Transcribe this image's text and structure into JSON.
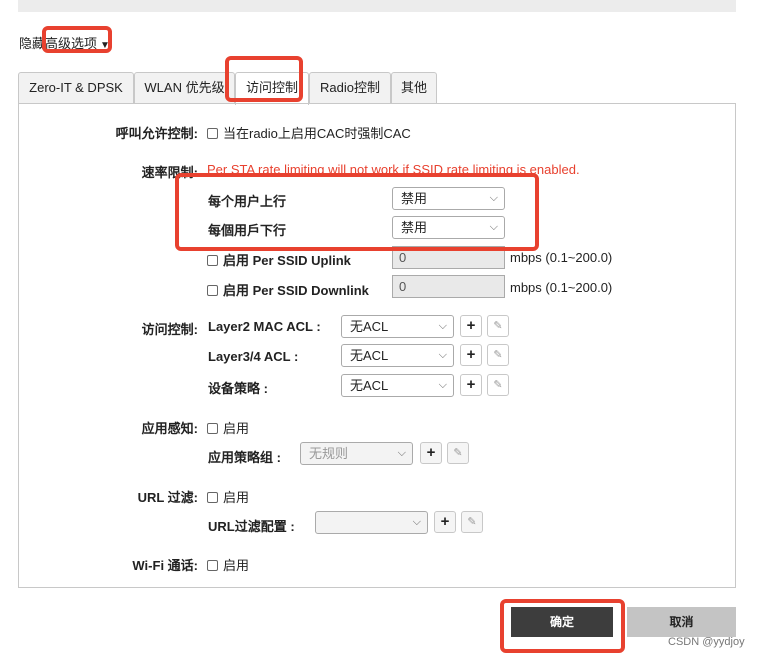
{
  "advanced_toggle": {
    "prefix": "隐藏",
    "highlight": "高级选项",
    "caret": "▼"
  },
  "tabs": [
    "Zero-IT & DPSK",
    "WLAN 优先级",
    "访问控制",
    "Radio控制",
    "其他"
  ],
  "call_admission": {
    "label": "呼叫允许控制:",
    "option": "当在radio上启用CAC时强制CAC"
  },
  "rate_limit": {
    "label": "速率限制:",
    "warning": "Per STA rate limiting will not work if SSID rate limiting is enabled.",
    "per_user_up_label": "每个用户上行",
    "per_user_up_value": "禁用",
    "per_user_down_label": "每個用戶下行",
    "per_user_down_value": "禁用",
    "ssid_uplink_label": "启用 Per SSID Uplink",
    "ssid_uplink_value": "0",
    "ssid_uplink_unit": "mbps (0.1~200.0)",
    "ssid_downlink_label": "启用 Per SSID Downlink",
    "ssid_downlink_value": "0",
    "ssid_downlink_unit": "mbps (0.1~200.0)"
  },
  "access_control": {
    "label": "访问控制:",
    "l2_label": "Layer2 MAC ACL :",
    "l2_value": "无ACL",
    "l34_label": "Layer3/4 ACL :",
    "l34_value": "无ACL",
    "device_label": "设备策略 :",
    "device_value": "无ACL"
  },
  "app_recognition": {
    "label": "应用感知:",
    "enable": "启用",
    "group_label": "应用策略组 :",
    "group_value": "无规则"
  },
  "url_filter": {
    "label": "URL 过滤:",
    "enable": "启用",
    "config_label": "URL过滤配置 :",
    "config_value": ""
  },
  "wifi_calling": {
    "label": "Wi-Fi 通话:",
    "enable": "启用"
  },
  "buttons": {
    "ok": "确定",
    "cancel": "取消"
  },
  "watermark": "CSDN @yydjoy",
  "colors": {
    "highlight_red": "#e8412f",
    "ok_button": "#3d3d3d",
    "cancel_button": "#c4c4c4"
  }
}
